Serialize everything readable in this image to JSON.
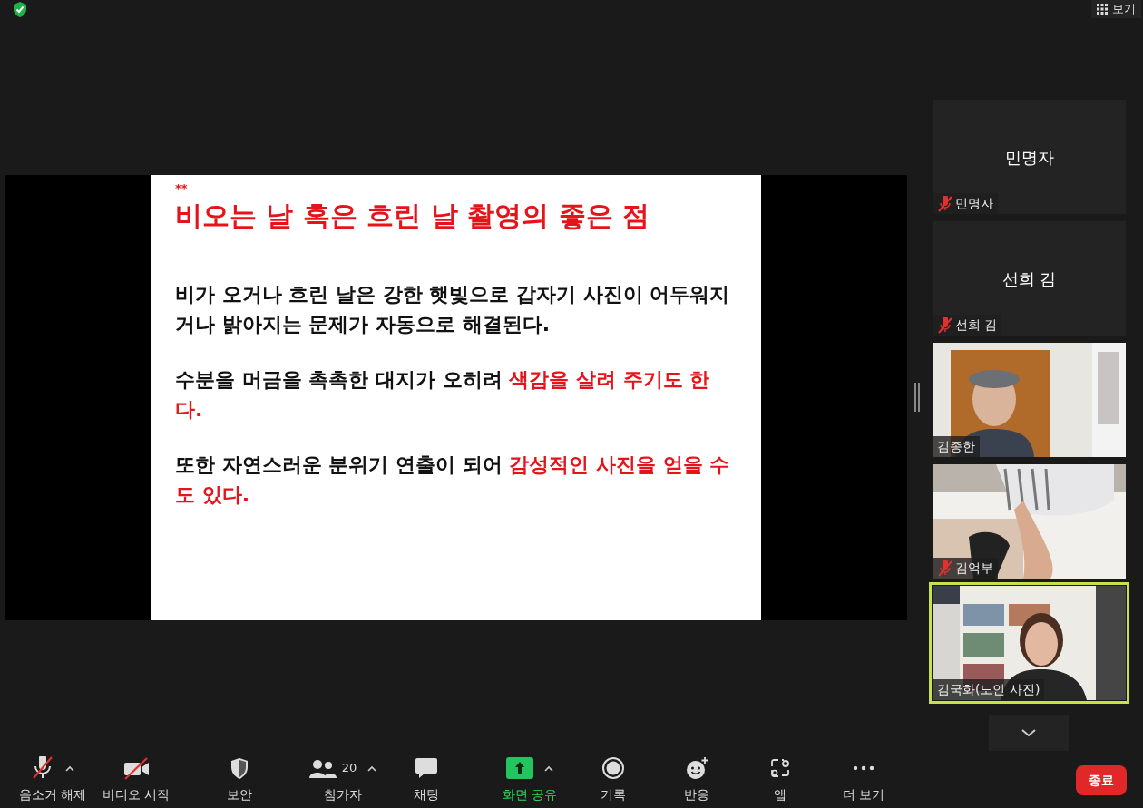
{
  "top_bar": {
    "view_button": {
      "label": "보기"
    }
  },
  "slide": {
    "marker": "**",
    "title": "비오는 날 혹은 흐린 날 촬영의 좋은 점",
    "paragraphs": [
      [
        {
          "text": "비가 오거나 흐린 날은 강한 햇빛으로 갑자기 사진이 어두워지거나 밝아지는 문제가 자동으로 해결된다.",
          "highlight": false
        }
      ],
      [
        {
          "text": "수분을 머금을 촉촉한 대지가 오히려 ",
          "highlight": false
        },
        {
          "text": "색감을 살려 주기도 한다.",
          "highlight": true
        }
      ],
      [
        {
          "text": "또한 자연스러운 분위기 연출이 되어 ",
          "highlight": false
        },
        {
          "text": "감성적인 사진을 얻을 수도 있다.",
          "highlight": true
        }
      ]
    ]
  },
  "participants": [
    {
      "kind": "avatar",
      "display_name": "민명자",
      "name": "민명자",
      "muted": true,
      "speaking": false
    },
    {
      "kind": "avatar",
      "display_name": "선희 김",
      "name": "선희 김",
      "muted": true,
      "speaking": false
    },
    {
      "kind": "video",
      "name": "김종한",
      "muted": false,
      "speaking": false
    },
    {
      "kind": "video",
      "name": "김억부",
      "muted": true,
      "speaking": false
    },
    {
      "kind": "video",
      "name": "김국화(노인 사진)",
      "muted": false,
      "speaking": true
    }
  ],
  "toolbar": [
    {
      "kind": "mic",
      "label": "음소거 해제",
      "off": true,
      "caret": true
    },
    {
      "kind": "camera",
      "label": "비디오 시작",
      "off": true,
      "caret": false
    },
    {
      "kind": "security",
      "label": "보안",
      "caret": false
    },
    {
      "kind": "participants",
      "label": "참가자",
      "count": "20",
      "caret": true
    },
    {
      "kind": "chat",
      "label": "채팅",
      "caret": false
    },
    {
      "kind": "share",
      "label": "화면 공유",
      "caret": true
    },
    {
      "kind": "record",
      "label": "기록",
      "caret": false
    },
    {
      "kind": "reactions",
      "label": "반응",
      "caret": false
    },
    {
      "kind": "apps",
      "label": "앱",
      "caret": false
    },
    {
      "kind": "more",
      "label": "더 보기",
      "caret": false
    }
  ],
  "end_button": {
    "label": "종료"
  }
}
